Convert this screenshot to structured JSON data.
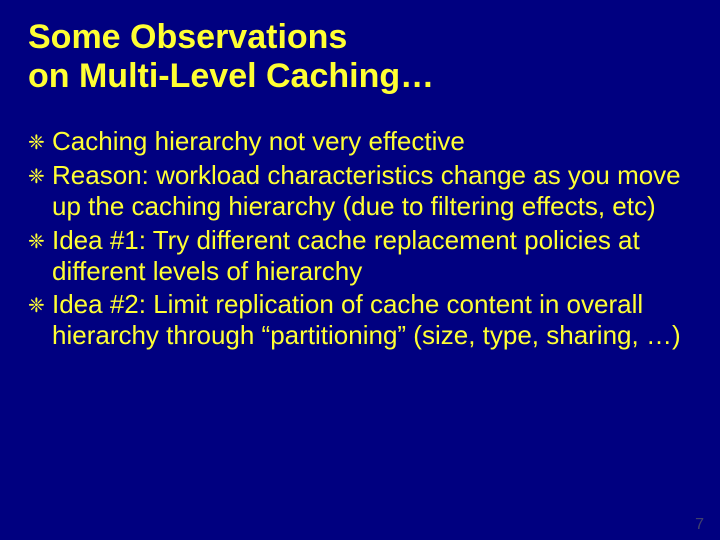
{
  "title_line1": "Some Observations",
  "title_line2": "on Multi-Level Caching…",
  "bullet_glyph": "❈",
  "items": [
    "Caching hierarchy not very effective",
    "Reason: workload characteristics change as you move up the caching hierarchy (due to filtering effects, etc)",
    "Idea #1: Try different cache replacement policies at different levels of hierarchy",
    "Idea #2: Limit replication of cache content in overall hierarchy through “partitioning” (size, type, sharing, …)"
  ],
  "page_number": "7"
}
